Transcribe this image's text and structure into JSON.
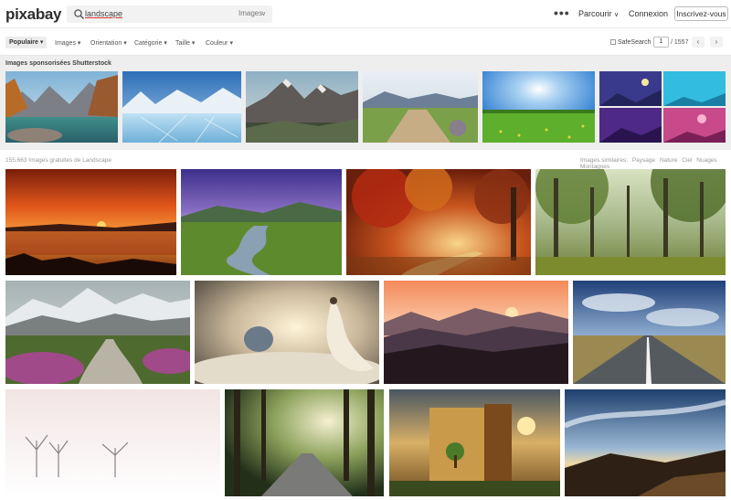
{
  "header": {
    "logo": "pixabay",
    "search_query": "landscape",
    "search_type": "Images",
    "menu_dots": "•••",
    "browse_label": "Parcourir",
    "login_label": "Connexion",
    "signup_label": "Inscrivez-vous"
  },
  "filters": {
    "sort_label": "Populaire",
    "items": [
      "Images",
      "Orientation",
      "Catégorie",
      "Taille",
      "Couleur"
    ],
    "safesearch_label": "SafeSearch",
    "current_page": "1",
    "total_pages": "/ 1557"
  },
  "sponsored": {
    "title": "Images sponsorisées Shutterstock"
  },
  "results": {
    "count_text": "155,663 Images gratuites de Landscape",
    "related_label": "Images similaires:",
    "related_tags": [
      "Paysage",
      "Nature",
      "Ciel",
      "Nuages",
      "Montagnes"
    ]
  },
  "icons": {
    "search": "search-icon",
    "chevron": "chevron-down-icon",
    "prev": "chevron-left-icon",
    "next": "chevron-right-icon"
  },
  "colors": {
    "accent": "#2e2e2e",
    "sponsored_bg": "#eeeeee"
  }
}
